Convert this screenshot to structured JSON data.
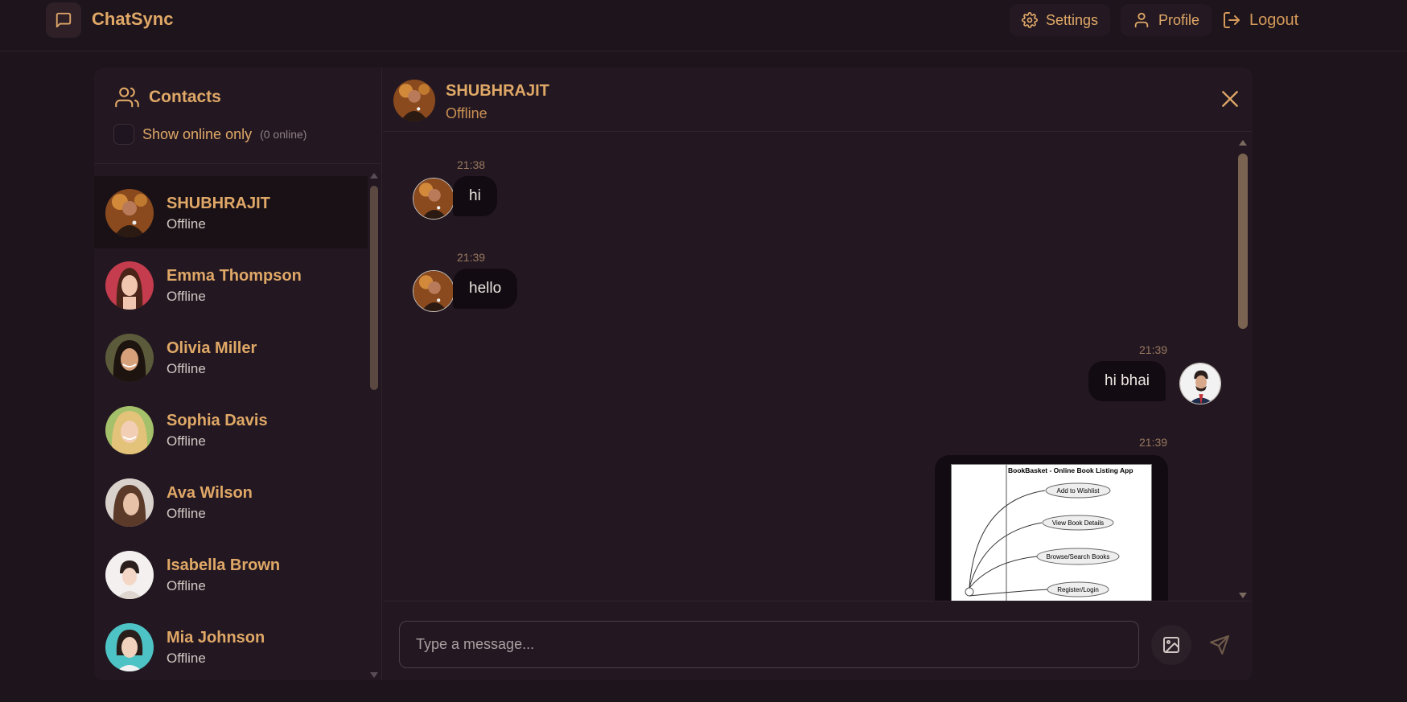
{
  "app": {
    "title": "ChatSync",
    "logo_icon": "message-square-icon",
    "accent_color": "#e0a867"
  },
  "header": {
    "settings_label": "Settings",
    "profile_label": "Profile",
    "logout_label": "Logout"
  },
  "sidebar": {
    "title": "Contacts",
    "show_online_label": "Show online only",
    "online_count": "(0 online)",
    "show_online_checked": false,
    "contacts": [
      {
        "name": "SHUBHRAJIT",
        "status": "Offline",
        "active": true
      },
      {
        "name": "Emma Thompson",
        "status": "Offline"
      },
      {
        "name": "Olivia Miller",
        "status": "Offline"
      },
      {
        "name": "Sophia Davis",
        "status": "Offline"
      },
      {
        "name": "Ava Wilson",
        "status": "Offline"
      },
      {
        "name": "Isabella Brown",
        "status": "Offline"
      },
      {
        "name": "Mia Johnson",
        "status": "Offline"
      }
    ]
  },
  "chat": {
    "contact_name": "SHUBHRAJIT",
    "contact_status": "Offline",
    "messages": [
      {
        "time": "21:38",
        "text": "hi",
        "from": "contact"
      },
      {
        "time": "21:39",
        "text": "hello",
        "from": "contact"
      },
      {
        "time": "21:39",
        "text": "hi bhai",
        "from": "me"
      },
      {
        "time": "21:39",
        "type": "image",
        "from": "me",
        "image_title": "BookBasket - Online Book Listing App",
        "diagram_labels": [
          "Add to Wishlist",
          "View Book Details",
          "Browse/Search Books",
          "Register/Login"
        ]
      }
    ],
    "input_placeholder": "Type a message..."
  }
}
